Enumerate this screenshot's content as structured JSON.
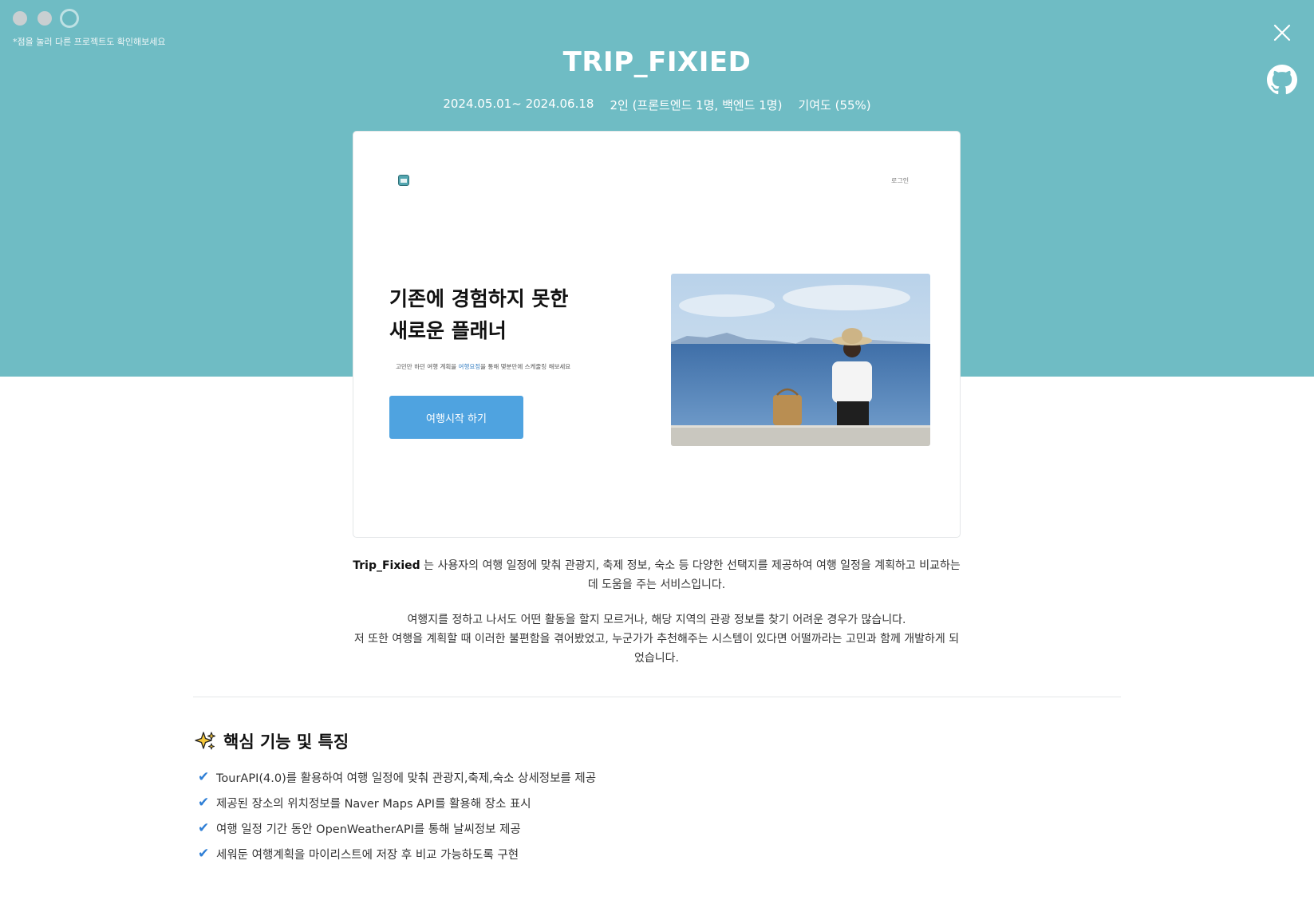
{
  "window": {
    "dots": [
      "project-1",
      "project-2",
      "project-3"
    ],
    "active_dot": 2,
    "dots_hint": "*점을 눌러 다른 프로젝트도 확인해보세요"
  },
  "header": {
    "title": "TRIP_FIXIED",
    "period": "2024.05.01~ 2024.06.18",
    "team": "2인 (프론트엔드 1명, 백엔드 1명)",
    "contribution": "기여도 (55%)"
  },
  "preview": {
    "login_label": "로그인",
    "hero_title_line1": "기존에 경험하지 못한",
    "hero_title_line2": "새로운 플래너",
    "hero_sub_before": "고민만 하던 여행 계획을 ",
    "hero_sub_highlight": "여행요정",
    "hero_sub_after": "을 통해 몇분만에 스케줄링 해보세요",
    "cta_label": "여행시작 하기"
  },
  "description": {
    "brand": "Trip_Fixied",
    "intro": " 는 사용자의 여행 일정에 맞춰 관광지, 축제 정보, 숙소 등 다양한 선택지를 제공하여 여행 일정을 계획하고 비교하는 데 도움을 주는 서비스입니다.",
    "motivation_line1": "여행지를 정하고 나서도 어떤 활동을 할지 모르거나, 해당 지역의 관광 정보를 찾기 어려운 경우가 많습니다.",
    "motivation_line2": "저 또한 여행을 계획할 때 이러한 불편함을 겪어봤었고, 누군가가 추천해주는 시스템이 있다면 어떨까라는 고민과 함께 개발하게 되었습니다."
  },
  "features": {
    "heading": "핵심 기능 및 특징",
    "items": [
      "TourAPI(4.0)를 활용하여 여행 일정에 맞춰 관광지,축제,숙소 상세정보를 제공",
      "제공된 장소의 위치정보를 Naver Maps API를 활용해 장소 표시",
      "여행 일정 기간 동안 OpenWeatherAPI를 통해 날씨정보 제공",
      "세워둔 여행계획을 마이리스트에 저장 후 비교 가능하도록 구현"
    ]
  },
  "colors": {
    "header_band": "#6fbcc4",
    "cta": "#4fa3e0",
    "check": "#2f7fd6"
  },
  "icons": {
    "close": "close-icon",
    "github": "github-icon",
    "sparkle": "sparkle-icon",
    "check": "check-icon"
  }
}
